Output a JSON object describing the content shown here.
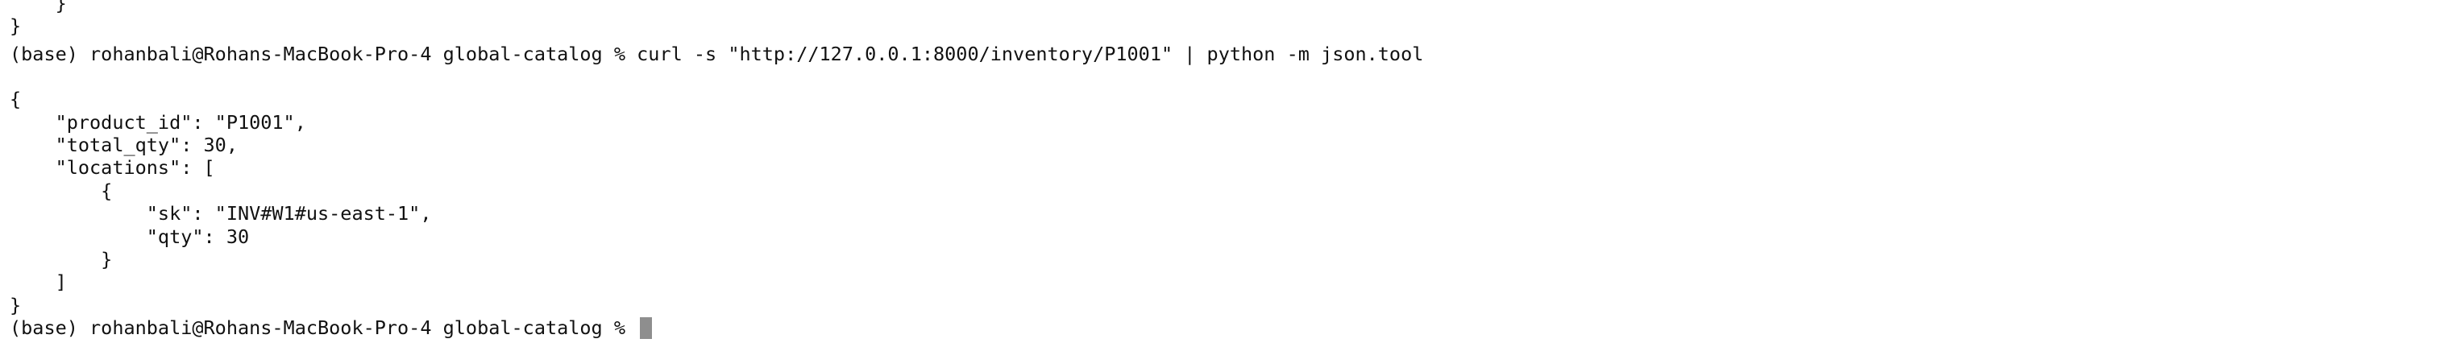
{
  "terminal": {
    "lines": [
      "    }",
      "}",
      "(base) rohanbali@Rohans-MacBook-Pro-4 global-catalog % curl -s \"http://127.0.0.1:8000/inventory/P1001\" | python -m json.tool",
      "",
      "{",
      "    \"product_id\": \"P1001\",",
      "    \"total_qty\": 30,",
      "    \"locations\": [",
      "        {",
      "            \"sk\": \"INV#W1#us-east-1\",",
      "            \"qty\": 30",
      "        }",
      "    ]",
      "}"
    ],
    "prompt": "(base) rohanbali@Rohans-MacBook-Pro-4 global-catalog % "
  }
}
